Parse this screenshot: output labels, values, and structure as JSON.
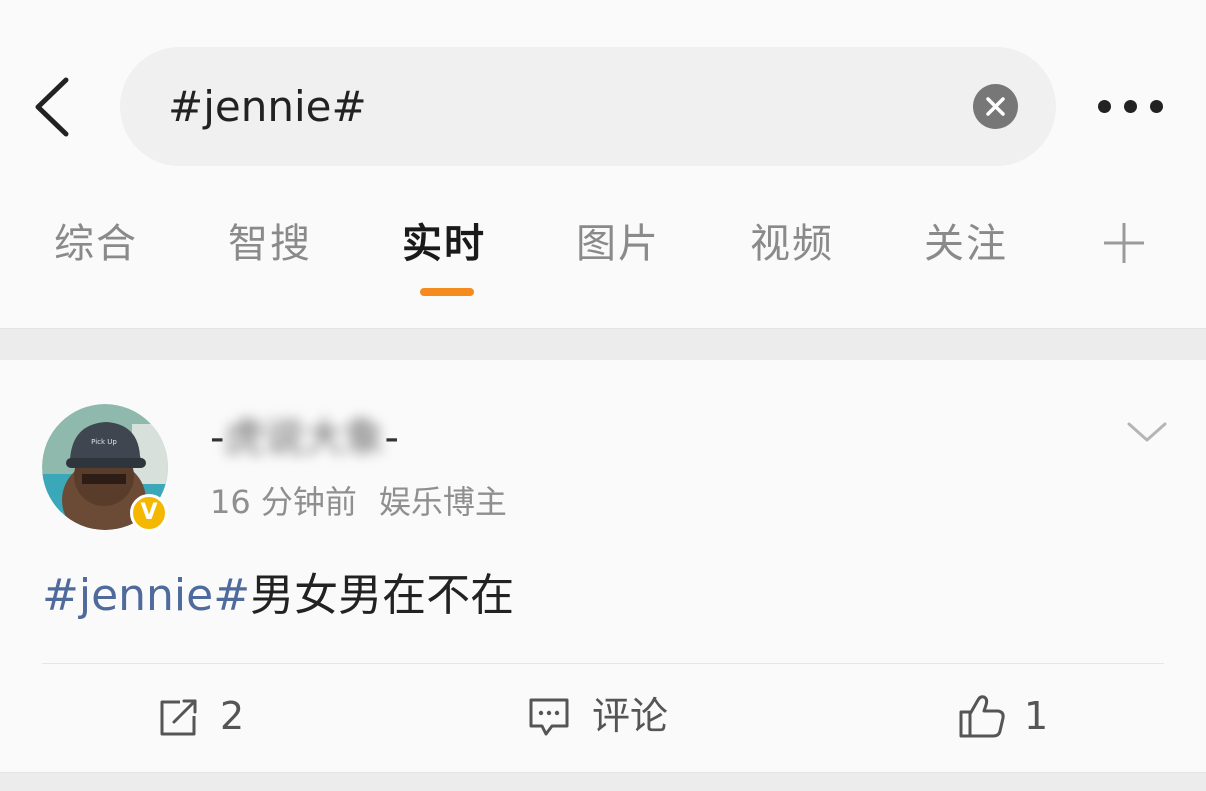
{
  "search": {
    "query": "#jennie#"
  },
  "tabs": [
    {
      "label": "综合",
      "active": false
    },
    {
      "label": "智搜",
      "active": false
    },
    {
      "label": "实时",
      "active": true
    },
    {
      "label": "图片",
      "active": false
    },
    {
      "label": "视频",
      "active": false
    },
    {
      "label": "关注",
      "active": false
    }
  ],
  "post": {
    "username_prefix": "-",
    "username_blurred": "虎说大象",
    "username_suffix": "-",
    "time": "16 分钟前",
    "role": "娱乐博主",
    "verified_badge": "V",
    "hashtag": "#jennie#",
    "text": "男女男在不在",
    "actions": {
      "repost_count": "2",
      "comment_label": "评论",
      "like_count": "1"
    }
  },
  "colors": {
    "accent": "#f58a1f",
    "hashtag": "#4f6b9c",
    "verified": "#f5b800"
  },
  "icons": [
    "back-icon",
    "clear-icon",
    "more-icon",
    "plus-icon",
    "chevron-down-icon",
    "repost-icon",
    "comment-icon",
    "like-icon"
  ]
}
